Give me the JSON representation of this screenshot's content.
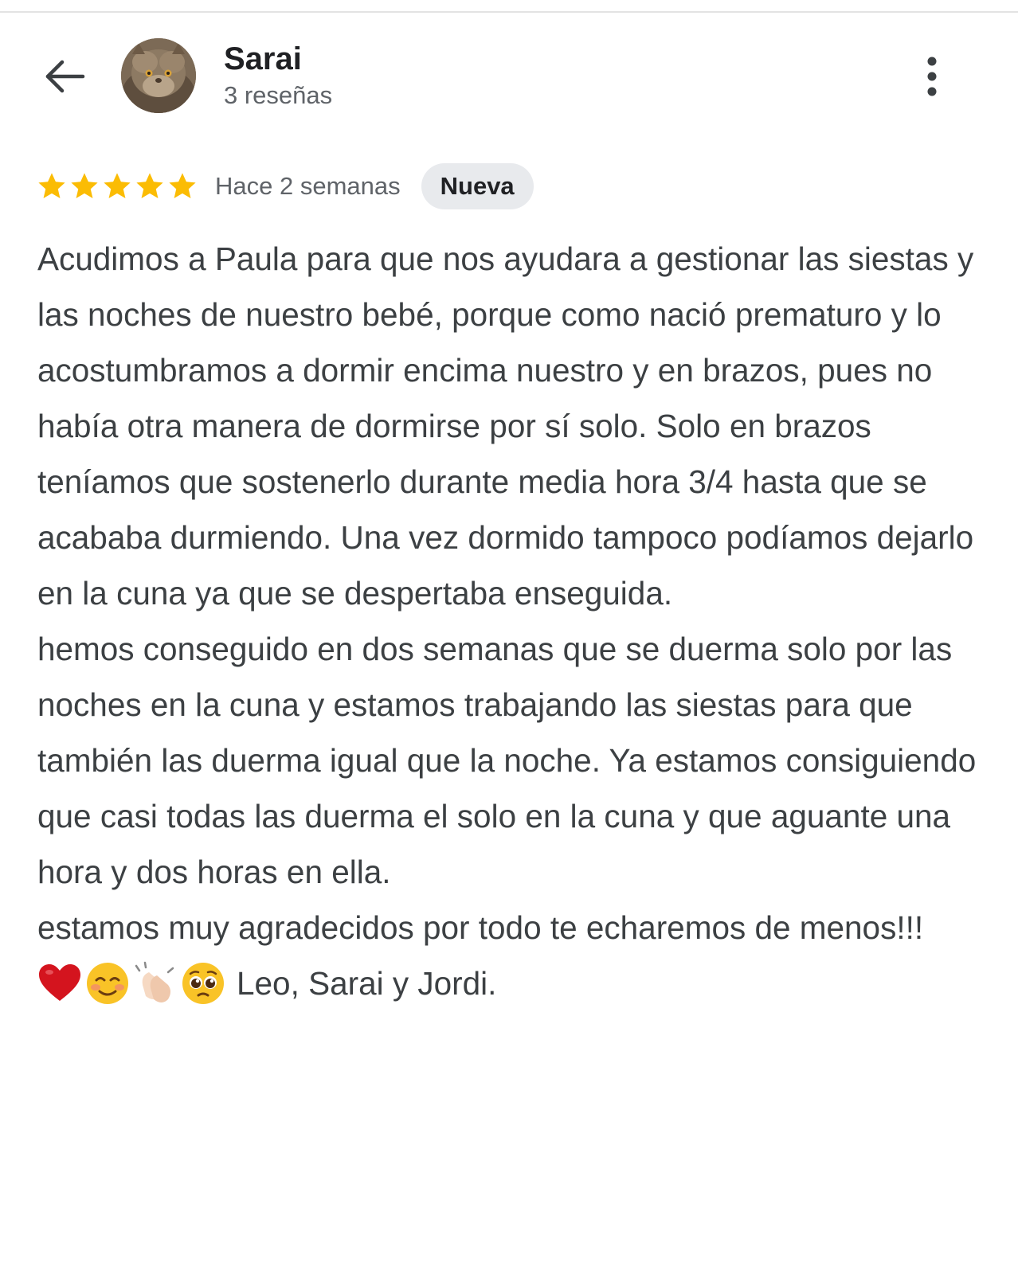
{
  "header": {
    "user_name": "Sarai",
    "user_sub": "3 reseñas"
  },
  "review": {
    "rating": 5,
    "time_ago": "Hace 2 semanas",
    "badge": "Nueva",
    "paragraphs": [
      "Acudimos a Paula para que nos ayudara a gestionar las siestas y las noches de nuestro bebé, porque como nació prematuro y lo acostumbramos a dormir encima nuestro y en brazos, pues no había otra manera de dormirse por sí solo. Solo en brazos teníamos que sostenerlo durante media hora 3/4 hasta que se acababa durmiendo. Una vez dormido tampoco podíamos dejarlo en la cuna ya que se despertaba enseguida.",
      "hemos conseguido en dos semanas que se duerma solo por las noches en la cuna y estamos trabajando las siestas para que también las duerma igual que la noche. Ya estamos consiguiendo que casi todas las duerma el solo en la cuna y que aguante una hora y dos horas en ella.",
      "estamos muy agradecidos por todo te echaremos de menos!!!"
    ],
    "signature": "Leo, Sarai y Jordi.",
    "emojis": [
      "red-heart",
      "smiling-face",
      "clapping-hands",
      "pleading-face"
    ]
  },
  "colors": {
    "star": "#fbbc04",
    "text": "#3c4043",
    "muted": "#5f6368",
    "badge_bg": "#e8eaed"
  }
}
